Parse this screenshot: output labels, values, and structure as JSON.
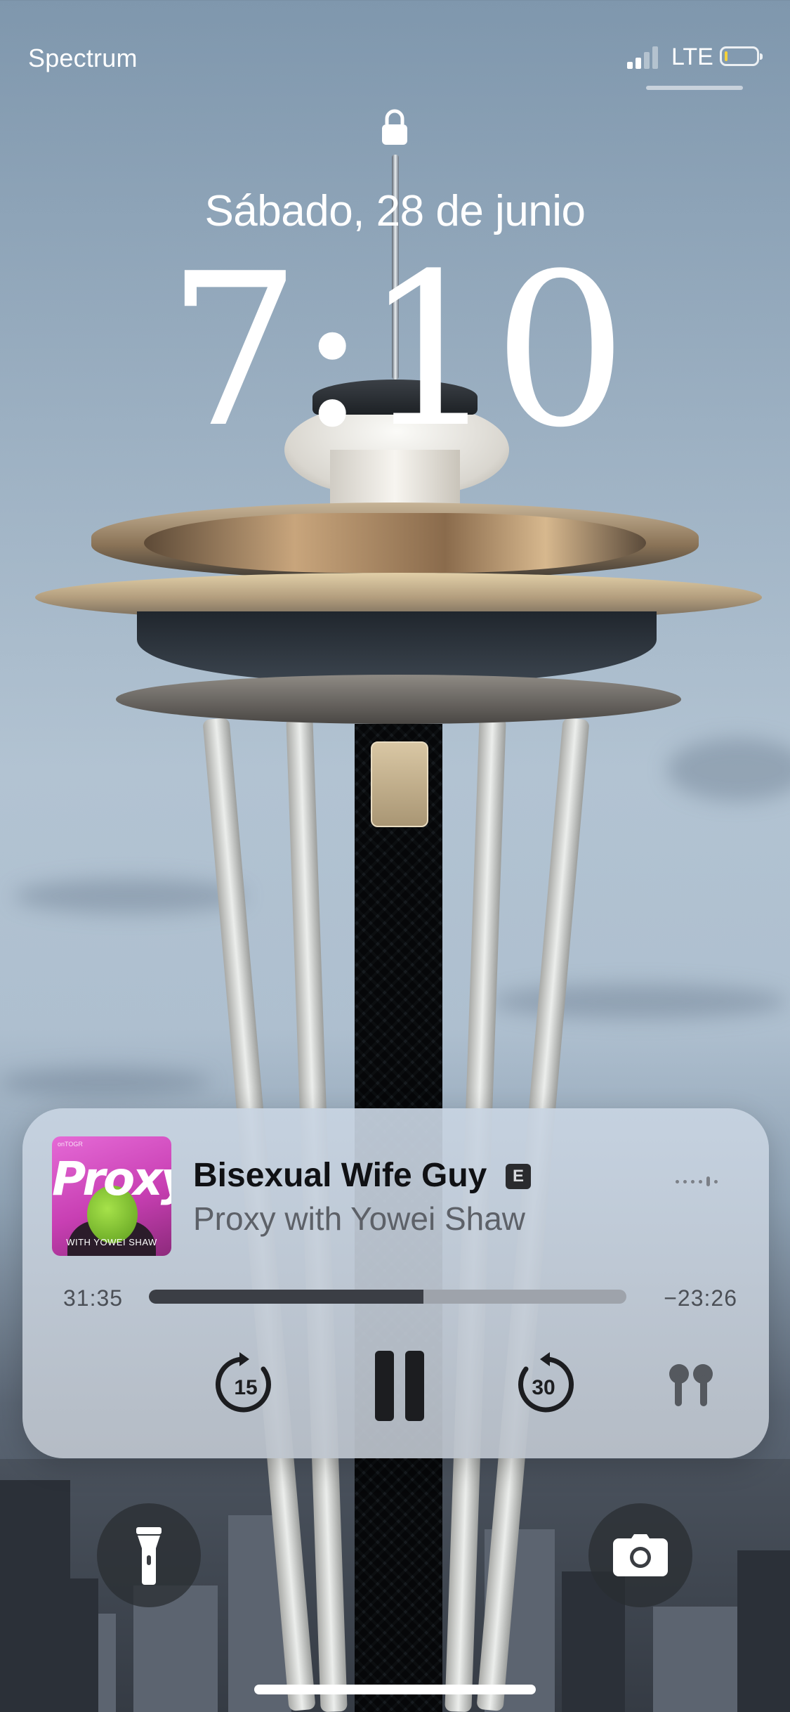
{
  "status_bar": {
    "carrier": "Spectrum",
    "network": "LTE",
    "signal_bars": 2,
    "battery_level": 0.1,
    "battery_color": "#f5d13a"
  },
  "lock_screen": {
    "lock_icon": "lock-icon",
    "date": "Sábado, 28 de junio",
    "time": "7:10"
  },
  "now_playing": {
    "artwork": {
      "title": "Proxy",
      "subtitle": "WITH YOWEI SHAW",
      "top_label": "onTOGR"
    },
    "track_title": "Bisexual Wife Guy",
    "explicit_badge": "E",
    "show_name": "Proxy with Yowei Shaw",
    "elapsed": "31:35",
    "remaining": "−23:26",
    "progress": 0.575,
    "controls": {
      "skip_back_seconds": "15",
      "skip_forward_seconds": "30",
      "pause_icon": "pause-icon",
      "output_icon": "airpods-icon",
      "waveform_icon": "waveform-icon"
    }
  },
  "bottom_controls": {
    "left_icon": "flashlight-icon",
    "right_icon": "camera-icon"
  }
}
